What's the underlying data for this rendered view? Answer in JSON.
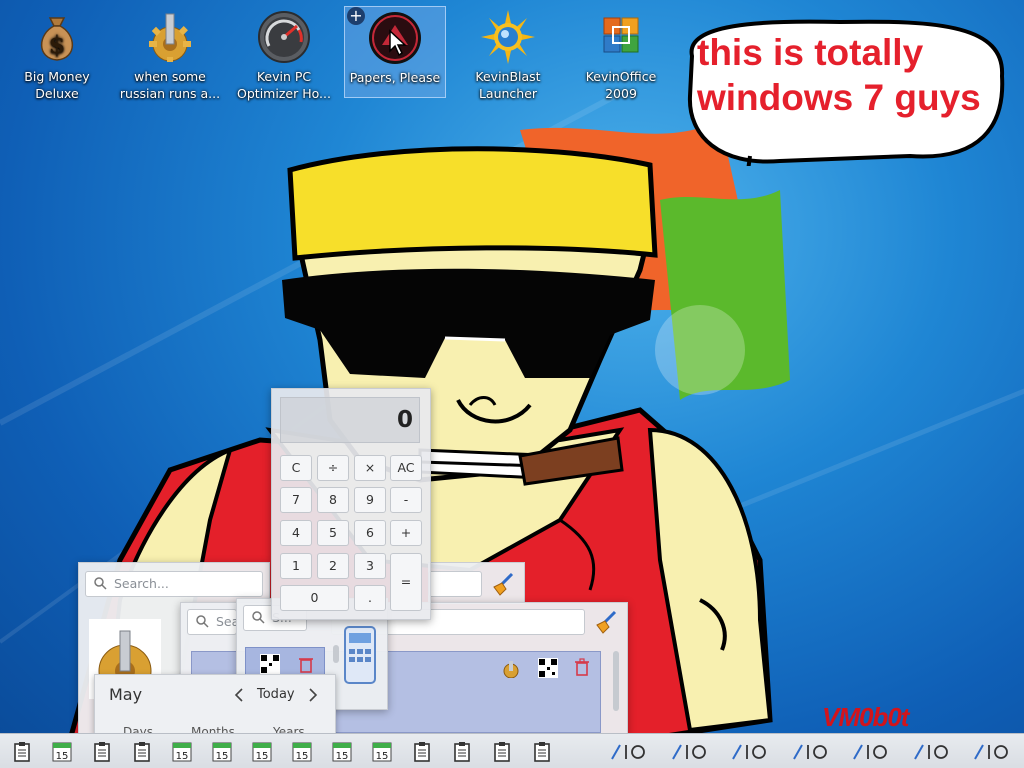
{
  "desktop": {
    "icons": [
      {
        "label_line1": "Big Money",
        "label_line2": "Deluxe",
        "icon": "money-bag-icon"
      },
      {
        "label_line1": "when some",
        "label_line2": "russian runs a...",
        "icon": "gear-icon"
      },
      {
        "label_line1": "Kevin PC",
        "label_line2": "Optimizer Ho...",
        "icon": "speedometer-icon"
      },
      {
        "label_line1": "Papers, Please",
        "label_line2": "",
        "icon": "papers-please-icon",
        "selected": true
      },
      {
        "label_line1": "KevinBlast",
        "label_line2": "Launcher",
        "icon": "sunburst-icon"
      },
      {
        "label_line1": "KevinOffice",
        "label_line2": "2009",
        "icon": "office-icon"
      }
    ],
    "selection_plus": "+",
    "bubble_text_line1": "this is totally",
    "bubble_text_line2": "windows 7 guys",
    "signature": "VM0b0t"
  },
  "calculator": {
    "display": "0",
    "keys": [
      "C",
      "÷",
      "×",
      "AC",
      "7",
      "8",
      "9",
      "-",
      "4",
      "5",
      "6",
      "+",
      "1",
      "2",
      "3",
      "=",
      "0",
      "."
    ]
  },
  "launcher": {
    "search_placeholder": "Search...",
    "search2_placeholder": "Sea",
    "search3_placeholder": "S..."
  },
  "calendar": {
    "month": "May",
    "today_label": "Today",
    "columns": [
      "Days",
      "Months",
      "Years"
    ]
  },
  "taskbar": {
    "calendar_day": "15",
    "items": [
      "clipboard",
      "calendar",
      "clipboard",
      "clipboard",
      "calendar",
      "calendar",
      "calendar",
      "calendar",
      "calendar",
      "calendar",
      "clipboard",
      "clipboard",
      "clipboard",
      "clipboard",
      "network",
      "network",
      "network",
      "network",
      "network",
      "network",
      "network"
    ]
  },
  "colors": {
    "desktop_blue": "#1f86d4",
    "bubble_text": "#e5202c",
    "hat_yellow": "#f7df2a",
    "shirt_red": "#e4202a",
    "skin": "#f8f0b0",
    "signature": "#d2141c"
  }
}
